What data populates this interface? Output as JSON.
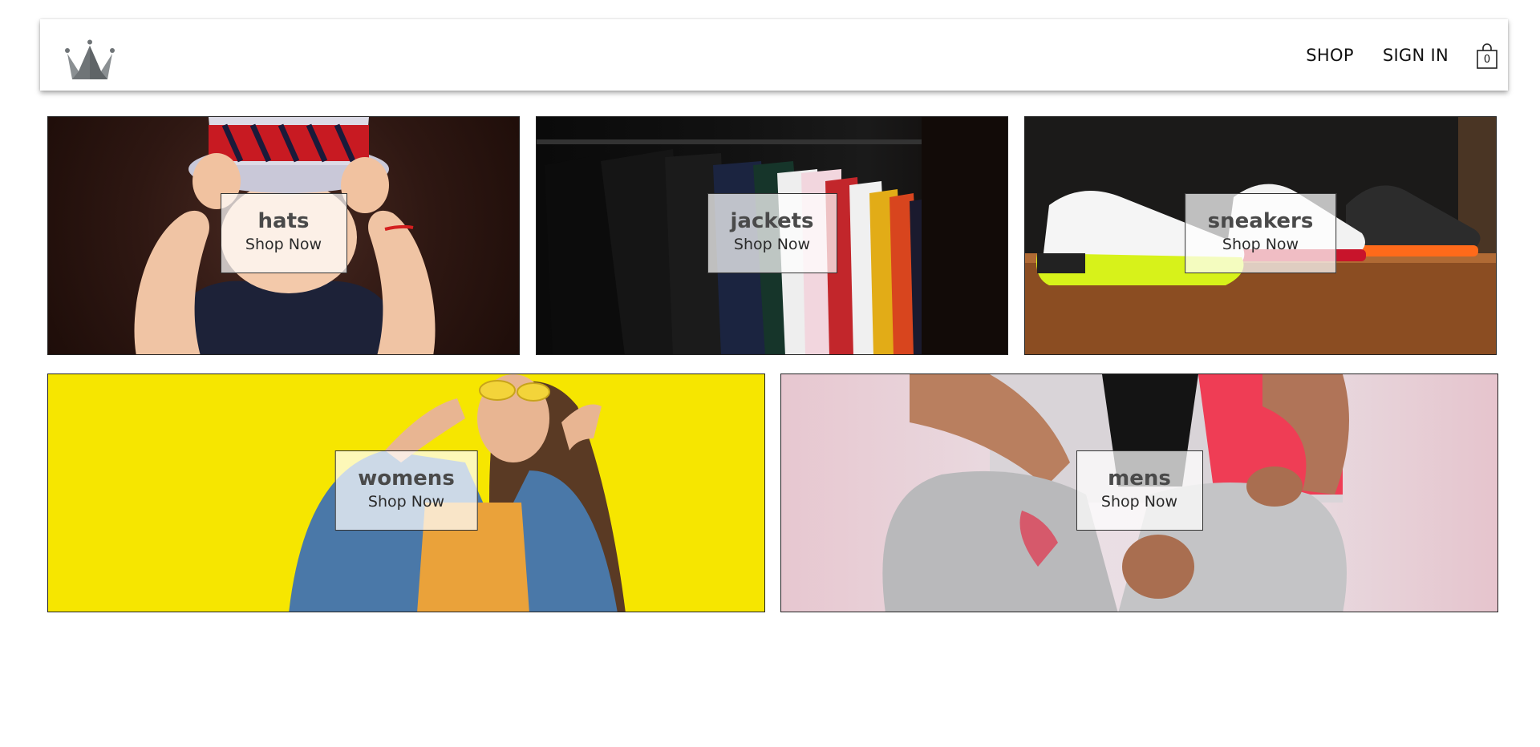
{
  "header": {
    "logo_icon": "crown-icon",
    "nav": {
      "shop_label": "SHOP",
      "sign_in_label": "SIGN IN"
    },
    "cart": {
      "icon": "shopping-bag-icon",
      "count": "0"
    }
  },
  "categories": [
    {
      "title": "hats",
      "cta": "Shop Now"
    },
    {
      "title": "jackets",
      "cta": "Shop Now"
    },
    {
      "title": "sneakers",
      "cta": "Shop Now"
    },
    {
      "title": "womens",
      "cta": "Shop Now"
    },
    {
      "title": "mens",
      "cta": "Shop Now"
    }
  ],
  "colors": {
    "womens_background": "#f6e600",
    "header_background": "#ffffff"
  }
}
